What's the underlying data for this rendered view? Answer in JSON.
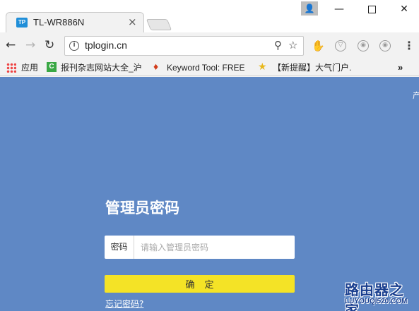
{
  "browser": {
    "tab": {
      "favicon": "TP",
      "title": "TL-WR886N",
      "close": "×"
    },
    "window_controls": {
      "minimize": "—",
      "close": "✕"
    },
    "address_bar": {
      "url": "tplogin.cn",
      "info_icon": "i"
    },
    "toolbar_icons": [
      "back-arrow-icon",
      "forward-arrow-icon",
      "reload-icon",
      "zoom-icon",
      "star-icon",
      "extension-icon",
      "shield-icon",
      "extension-icon",
      "extension-icon",
      "menu-icon"
    ],
    "bookmarks": {
      "apps_label": "应用",
      "items": [
        {
          "label": "报刊杂志网站大全_沪",
          "icon": "c-favicon-icon"
        },
        {
          "label": "Keyword Tool: FREE",
          "icon": "keyword-favicon-icon"
        },
        {
          "label": "【新提醒】大气门户.",
          "icon": "trophy-favicon-icon"
        }
      ],
      "more": "»"
    }
  },
  "page": {
    "corner_text": "产",
    "heading": "管理员密码",
    "password": {
      "label": "密码",
      "value": "",
      "placeholder": "请输入管理员密码"
    },
    "confirm_label": "确定",
    "forgot_label": "忘记密码?",
    "watermark": {
      "cn": "路由器之家",
      "en": "LUYOUQI520.COM"
    }
  },
  "colors": {
    "page_background": "#5f88c5",
    "confirm_button": "#f4e326",
    "watermark": "#1a3f8f"
  }
}
